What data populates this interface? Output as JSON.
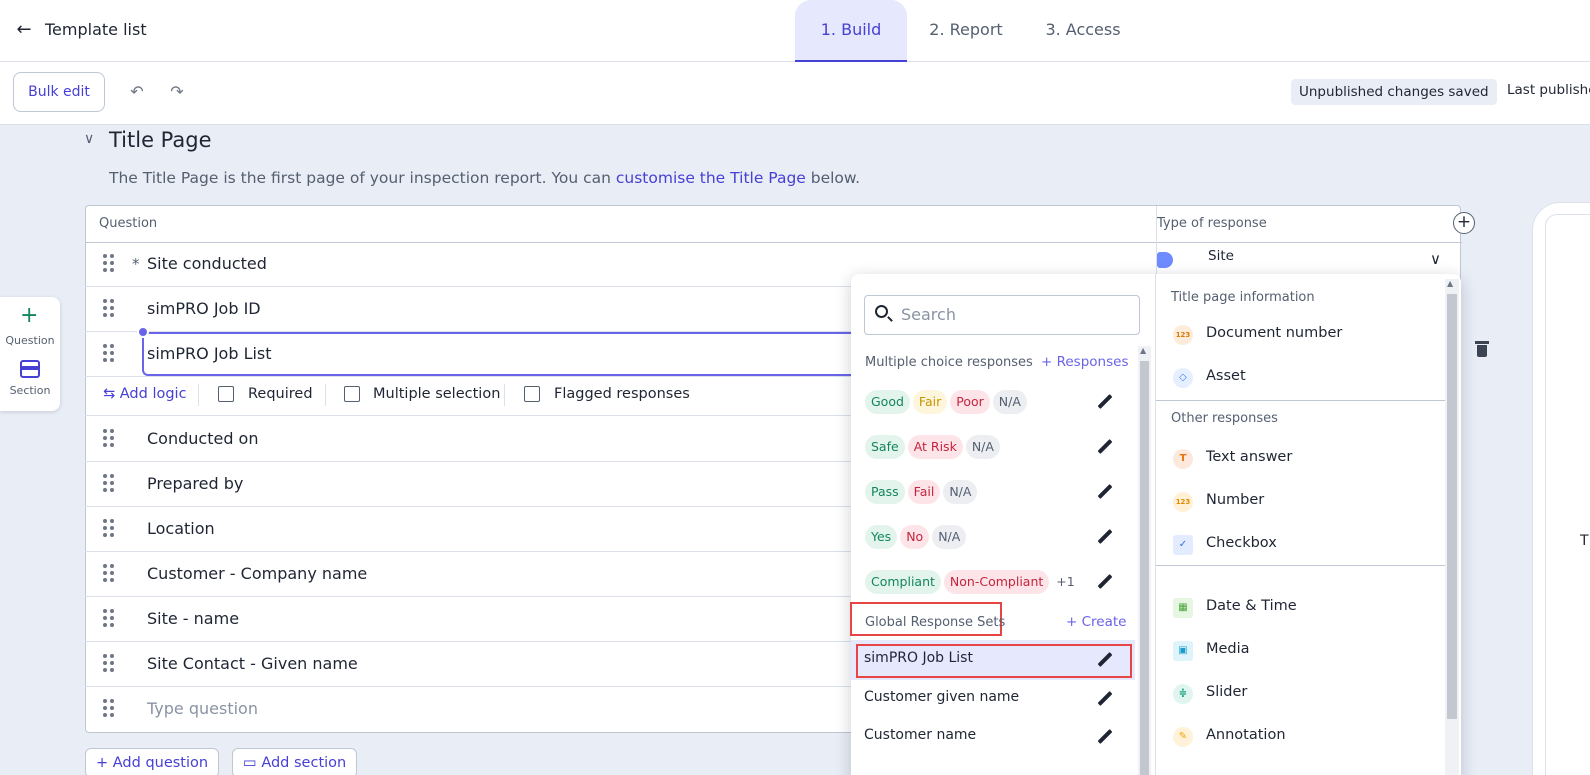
{
  "header": {
    "back_icon": "arrow-left-icon",
    "title": "Template list",
    "tabs": [
      {
        "label": "1. Build",
        "active": true
      },
      {
        "label": "2. Report",
        "active": false
      },
      {
        "label": "3. Access",
        "active": false
      }
    ]
  },
  "toolbar": {
    "bulk_edit": "Bulk edit",
    "status": "Unpublished changes saved",
    "last_published": "Last published"
  },
  "section": {
    "title": "Title Page",
    "desc_pre": "The Title Page is the first page of your inspection report. You can ",
    "desc_link": "customise the Title Page",
    "desc_post": " below."
  },
  "side_panel": {
    "question": "Question",
    "section": "Section"
  },
  "table": {
    "col_question": "Question",
    "col_response": "Type of response",
    "rows": [
      {
        "label": "Site conducted",
        "required": true,
        "response": "Site"
      },
      {
        "label": "simPRO Job ID"
      },
      {
        "label": "simPRO Job List"
      },
      {
        "label": "Conducted on"
      },
      {
        "label": "Prepared by"
      },
      {
        "label": "Location"
      },
      {
        "label": "Customer - Company name"
      },
      {
        "label": "Site - name"
      },
      {
        "label": "Site Contact - Given name"
      },
      {
        "placeholder": "Type question"
      }
    ],
    "logic": {
      "add_logic": "Add logic",
      "required": "Required",
      "multiple": "Multiple selection",
      "flagged": "Flagged responses"
    },
    "required_mark": "*"
  },
  "buttons": {
    "add_question": "+ Add question",
    "add_section": "Add section"
  },
  "preview": {
    "text": "T"
  },
  "dropdown": {
    "search_placeholder": "Search",
    "mc_header": "Multiple choice responses",
    "mc_link": "+ Responses",
    "mc_sets": [
      [
        {
          "t": "Good",
          "c": "green"
        },
        {
          "t": "Fair",
          "c": "yellow"
        },
        {
          "t": "Poor",
          "c": "red"
        },
        {
          "t": "N/A",
          "c": "grey"
        }
      ],
      [
        {
          "t": "Safe",
          "c": "green"
        },
        {
          "t": "At Risk",
          "c": "red"
        },
        {
          "t": "N/A",
          "c": "grey"
        }
      ],
      [
        {
          "t": "Pass",
          "c": "green"
        },
        {
          "t": "Fail",
          "c": "red"
        },
        {
          "t": "N/A",
          "c": "grey"
        }
      ],
      [
        {
          "t": "Yes",
          "c": "green"
        },
        {
          "t": "No",
          "c": "red"
        },
        {
          "t": "N/A",
          "c": "grey"
        }
      ],
      [
        {
          "t": "Compliant",
          "c": "green"
        },
        {
          "t": "Non-Compliant",
          "c": "red"
        }
      ]
    ],
    "more_count": "+1",
    "global_header": "Global Response Sets",
    "global_link": "+ Create",
    "global_sets": [
      "simPRO Job List",
      "Customer given name",
      "Customer name"
    ],
    "right": {
      "h1": "Title page information",
      "items1": [
        {
          "label": "Document number",
          "icon": "number-icon",
          "glyph": "123",
          "bg": "#fdecd9",
          "fg": "#d9780b"
        },
        {
          "label": "Asset",
          "icon": "cube-icon",
          "glyph": "◇",
          "bg": "#e6efff",
          "fg": "#3d7bf0"
        }
      ],
      "h2": "Other responses",
      "items2": [
        {
          "label": "Text answer",
          "icon": "text-icon",
          "glyph": "T",
          "bg": "#fde9dc",
          "fg": "#e8720d"
        },
        {
          "label": "Number",
          "icon": "number-icon",
          "glyph": "123",
          "bg": "#fff0d6",
          "fg": "#e08b00"
        },
        {
          "label": "Checkbox",
          "icon": "checkbox-icon",
          "glyph": "✓",
          "bg": "#e3ecff",
          "fg": "#2f6fe6"
        }
      ],
      "items3": [
        {
          "label": "Date & Time",
          "icon": "calendar-icon",
          "glyph": "▦",
          "bg": "#e6f6e1",
          "fg": "#48a33a"
        },
        {
          "label": "Media",
          "icon": "media-icon",
          "glyph": "▣",
          "bg": "#dff3fb",
          "fg": "#1a9dcc"
        },
        {
          "label": "Slider",
          "icon": "slider-icon",
          "glyph": "≑",
          "bg": "#e0f5ef",
          "fg": "#1aa57c"
        },
        {
          "label": "Annotation",
          "icon": "annotation-icon",
          "glyph": "✎",
          "bg": "#fff2d9",
          "fg": "#f0a500"
        }
      ]
    }
  }
}
